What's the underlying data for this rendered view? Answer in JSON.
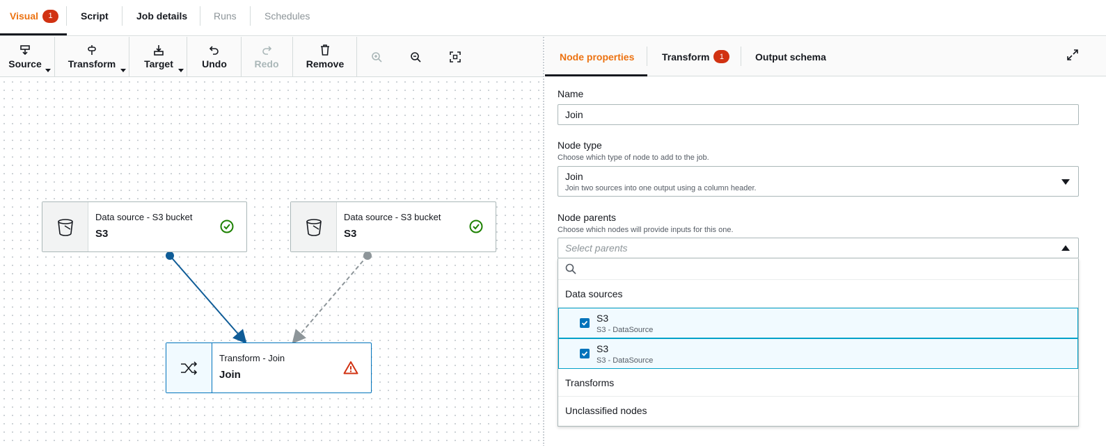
{
  "top_tabs": [
    {
      "label": "Visual",
      "badge": "1"
    },
    {
      "label": "Script"
    },
    {
      "label": "Job details"
    },
    {
      "label": "Runs"
    },
    {
      "label": "Schedules"
    }
  ],
  "toolbar": {
    "source": "Source",
    "transform": "Transform",
    "target": "Target",
    "undo": "Undo",
    "redo": "Redo",
    "remove": "Remove"
  },
  "nodes": [
    {
      "label": "Data source - S3 bucket",
      "title": "S3",
      "status": "success"
    },
    {
      "label": "Data source - S3 bucket",
      "title": "S3",
      "status": "success"
    },
    {
      "label": "Transform - Join",
      "title": "Join",
      "status": "warning"
    }
  ],
  "panel": {
    "tabs": [
      {
        "label": "Node properties"
      },
      {
        "label": "Transform",
        "badge": "1"
      },
      {
        "label": "Output schema"
      }
    ],
    "name_label": "Name",
    "name_value": "Join",
    "node_type_label": "Node type",
    "node_type_desc": "Choose which type of node to add to the job.",
    "node_type_value": "Join",
    "node_type_value_desc": "Join two sources into one output using a column header.",
    "node_parents_label": "Node parents",
    "node_parents_desc": "Choose which nodes will provide inputs for this one.",
    "node_parents_placeholder": "Select parents",
    "dropdown": {
      "group_data_sources": "Data sources",
      "options": [
        {
          "title": "S3",
          "subtitle": "S3 - DataSource",
          "checked": true
        },
        {
          "title": "S3",
          "subtitle": "S3 - DataSource",
          "checked": true
        }
      ],
      "group_transforms": "Transforms",
      "group_unclassified": "Unclassified nodes"
    }
  },
  "colors": {
    "accent": "#ec7211",
    "link_blue": "#0073bb",
    "error_red": "#d13212",
    "success_green": "#1d8102"
  }
}
